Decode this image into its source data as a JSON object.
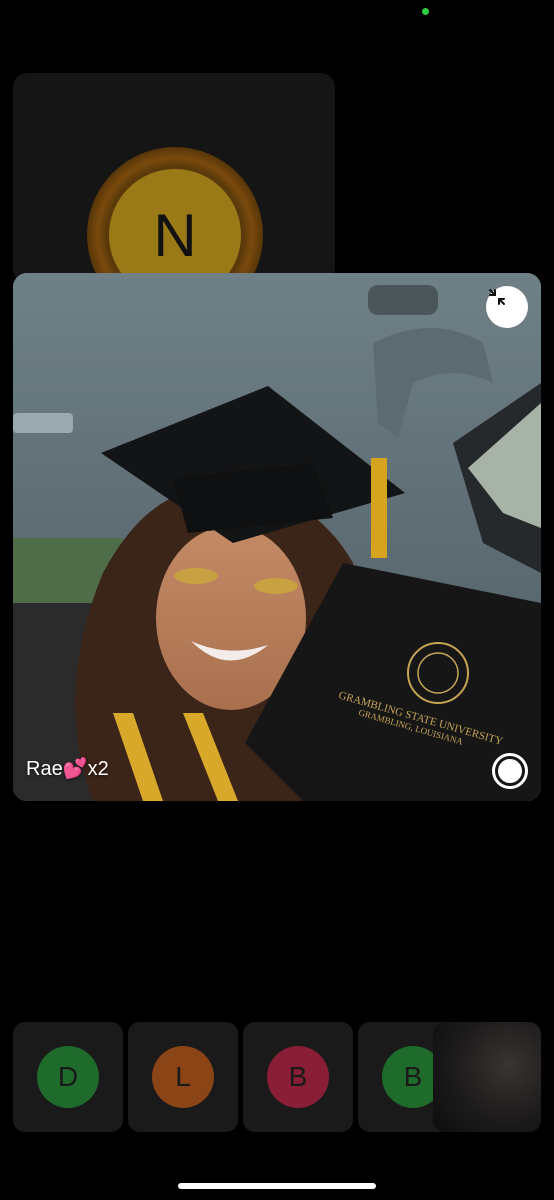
{
  "background_participant": {
    "initial": "N",
    "color": "#9a7a16"
  },
  "video": {
    "caption": "Rae💕x2",
    "folder_text_line1": "GRAMBLING STATE UNIVERSITY",
    "folder_text_line2": "GRAMBLING, LOUISIANA"
  },
  "participants": [
    {
      "initial": "D",
      "color": "#1f6b2c"
    },
    {
      "initial": "L",
      "color": "#8a4416"
    },
    {
      "initial": "B",
      "color": "#8a1e36"
    },
    {
      "initial": "B",
      "color": "#1f6b2c"
    }
  ],
  "icons": {
    "minimize": "minimize-arrows-icon",
    "shutter": "capture-icon"
  }
}
